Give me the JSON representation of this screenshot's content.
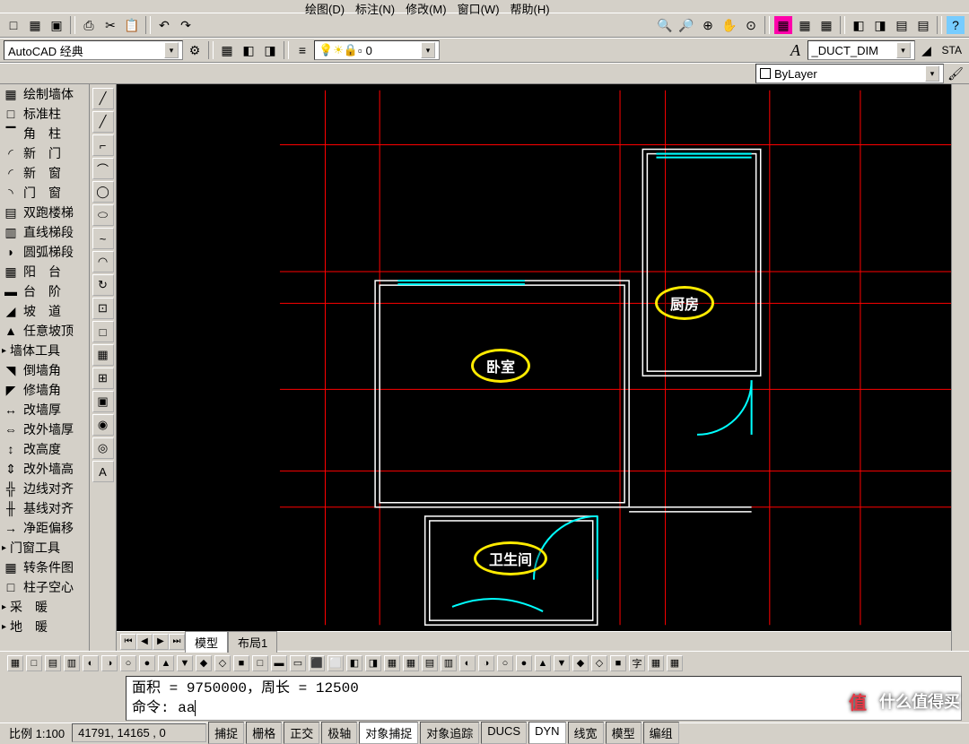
{
  "menu": {
    "items": [
      "绘图(D)",
      "标注(N)",
      "修改(M)",
      "窗口(W)",
      "帮助(H)"
    ]
  },
  "toolbar1_icons": [
    "□",
    "▦",
    "▣",
    "⎙",
    "✂",
    "📋",
    "↶",
    "↷",
    "⎙",
    "⤴"
  ],
  "workspace": {
    "label": "AutoCAD 经典"
  },
  "toolbar2_left_icons": [
    "▦",
    "◧",
    "◨",
    "▤"
  ],
  "toolbar2_mid_icons": [
    "≡",
    "◐",
    "○",
    "◑",
    "⬡",
    "◻",
    "0"
  ],
  "layer_label": "0",
  "toolbar2_right_icons": [
    "🔍",
    "🔎",
    "⊕",
    "✋",
    "⊙",
    "▦",
    "▦",
    "▦",
    "◧",
    "◨",
    "▤",
    "▤",
    "?"
  ],
  "linetype": {
    "label": "ByLayer"
  },
  "textstyle": {
    "label": "_DUCT_DIM"
  },
  "sta_label": "STA",
  "left_tools": [
    {
      "icon": "▦",
      "label": "绘制墙体"
    },
    {
      "icon": "□",
      "label": "标准柱"
    },
    {
      "icon": "▔",
      "label": "角　柱"
    },
    {
      "icon": "◜",
      "label": "新　门"
    },
    {
      "icon": "◜",
      "label": "新　窗"
    },
    {
      "icon": "◝",
      "label": "门　窗"
    },
    {
      "icon": "▤",
      "label": "双跑楼梯"
    },
    {
      "icon": "▥",
      "label": "直线梯段"
    },
    {
      "icon": "◗",
      "label": "圆弧梯段"
    },
    {
      "icon": "▦",
      "label": "阳　台"
    },
    {
      "icon": "▬",
      "label": "台　阶"
    },
    {
      "icon": "◢",
      "label": "坡　道"
    },
    {
      "icon": "▲",
      "label": "任意坡顶"
    }
  ],
  "left_section1": "墙体工具",
  "left_tools2": [
    {
      "icon": "◥",
      "label": "倒墙角"
    },
    {
      "icon": "◤",
      "label": "修墙角"
    },
    {
      "icon": "↔",
      "label": "改墙厚"
    },
    {
      "icon": "⇔",
      "label": "改外墙厚"
    },
    {
      "icon": "↕",
      "label": "改高度"
    },
    {
      "icon": "⇕",
      "label": "改外墙高"
    },
    {
      "icon": "╬",
      "label": "边线对齐"
    },
    {
      "icon": "╫",
      "label": "基线对齐"
    },
    {
      "icon": "→",
      "label": "净距偏移"
    }
  ],
  "left_section2": "门窗工具",
  "left_tools3": [
    {
      "icon": "▦",
      "label": "转条件图"
    },
    {
      "icon": "□",
      "label": "柱子空心"
    }
  ],
  "left_section3": "采　暖",
  "left_section4": "地　暖",
  "scale_label": "比例 1:100",
  "vtool_icons": [
    "╱",
    "╱",
    "⌐",
    "⌒",
    "◯",
    "⬭",
    "~",
    "◠",
    "↻",
    "⊡",
    "□",
    "▦",
    "⊞",
    "▣",
    "◉",
    "◎",
    "A"
  ],
  "room_labels": {
    "bedroom": "卧室",
    "kitchen": "厨房",
    "bathroom": "卫生间"
  },
  "tabs": {
    "model": "模型",
    "layout1": "布局1"
  },
  "icon_row": [
    "▦",
    "□",
    "▤",
    "▥",
    "◐",
    "◑",
    "○",
    "●",
    "▲",
    "▼",
    "◆",
    "◇",
    "■",
    "□",
    "▬",
    "▭",
    "⬛",
    "⬜",
    "◧",
    "◨",
    "▦",
    "▦",
    "▤",
    "▥",
    "◐",
    "◑",
    "○",
    "●",
    "▲",
    "▼",
    "◆",
    "◇",
    "■",
    "字",
    "▦",
    "▦"
  ],
  "cmd": {
    "line1_prefix": "面积 = ",
    "area_value": "9750000",
    "line1_mid": "，周长 = ",
    "perim_value": "12500",
    "prompt": "命令: ",
    "input": "aa"
  },
  "status": {
    "coords": "41791, 14165 , 0",
    "items": [
      "捕捉",
      "栅格",
      "正交",
      "极轴",
      "对象捕捉",
      "对象追踪",
      "DUCS",
      "DYN",
      "线宽",
      "模型",
      "编组"
    ]
  },
  "watermark": "什么值得买"
}
